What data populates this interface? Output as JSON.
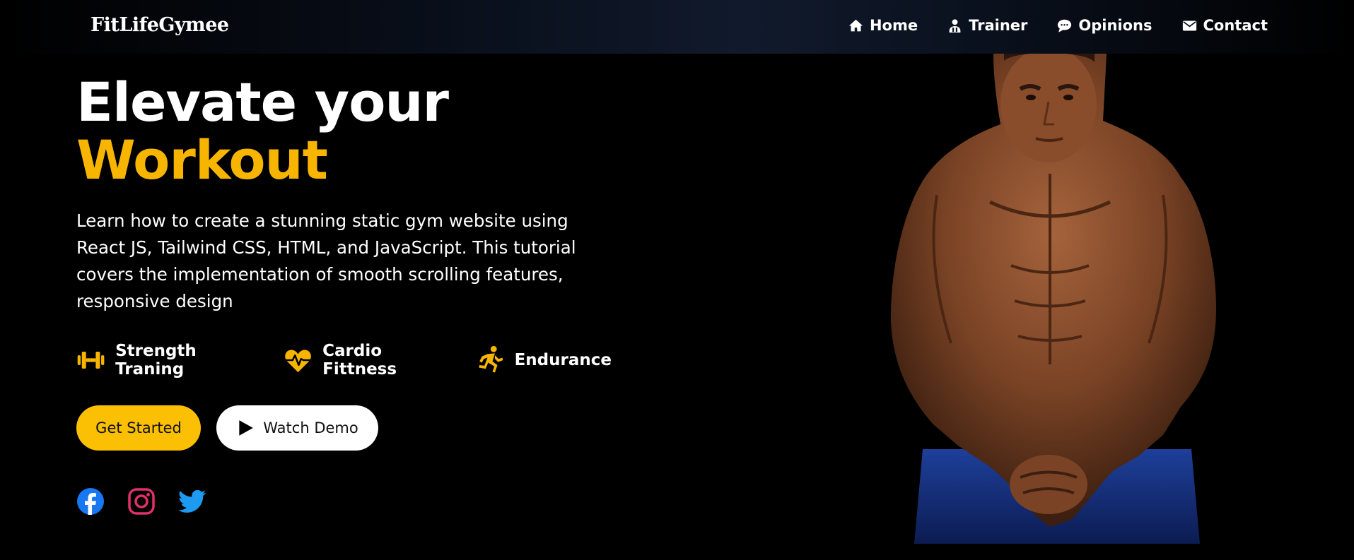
{
  "brand": {
    "name": "FitLifeGymee"
  },
  "nav": {
    "items": [
      {
        "label": "Home",
        "icon": "home-icon"
      },
      {
        "label": "Trainer",
        "icon": "trainer-icon"
      },
      {
        "label": "Opinions",
        "icon": "chat-icon"
      },
      {
        "label": "Contact",
        "icon": "envelope-icon"
      }
    ]
  },
  "hero": {
    "title_line1": "Elevate your",
    "title_line2": "Workout",
    "description": "Learn how to create a stunning static gym website using React JS, Tailwind CSS, HTML, and JavaScript. This tutorial covers the implementation of smooth scrolling features, responsive design",
    "features": [
      {
        "label": "Strength Traning",
        "icon": "dumbbell-icon"
      },
      {
        "label": "Cardio Fittness",
        "icon": "heartbeat-icon"
      },
      {
        "label": "Endurance",
        "icon": "running-icon"
      }
    ],
    "buttons": {
      "primary": "Get Started",
      "secondary": "Watch Demo"
    },
    "socials": [
      {
        "name": "facebook",
        "icon": "facebook-icon",
        "color": "#1877f2"
      },
      {
        "name": "instagram",
        "icon": "instagram-icon",
        "color": "#e1306c"
      },
      {
        "name": "twitter",
        "icon": "twitter-icon",
        "color": "#1d9bf0"
      }
    ]
  },
  "colors": {
    "background": "#000000",
    "accent": "#f7b500",
    "button_primary": "#fbbf04",
    "button_secondary": "#ffffff"
  }
}
